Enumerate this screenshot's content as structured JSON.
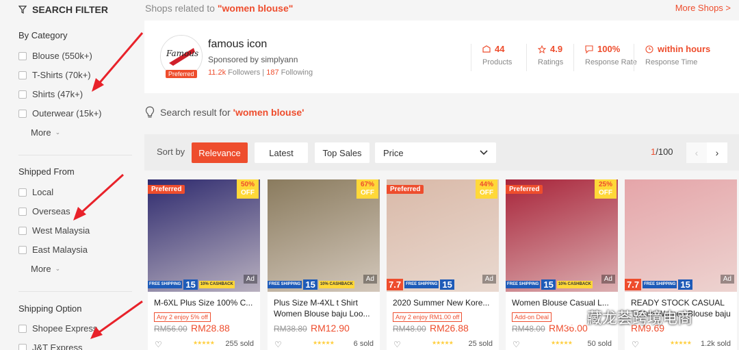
{
  "sidebar": {
    "title": "SEARCH FILTER",
    "sections": [
      {
        "title": "By Category",
        "items": [
          "Blouse (550k+)",
          "T-Shirts (70k+)",
          "Shirts (47k+)",
          "Outerwear (15k+)"
        ],
        "more": "More"
      },
      {
        "title": "Shipped From",
        "items": [
          "Local",
          "Overseas",
          "West Malaysia",
          "East Malaysia"
        ],
        "more": "More"
      },
      {
        "title": "Shipping Option",
        "items": [
          "Shopee Express",
          "J&T Express"
        ]
      }
    ]
  },
  "top": {
    "related_prefix": "Shops related to ",
    "related_keyword": "\"women blouse\"",
    "more_shops": "More Shops >"
  },
  "shop": {
    "name": "famous icon",
    "sponsor": "Sponsored by simplyann",
    "followers_num": "11.2k",
    "followers_label": "Followers",
    "sep": "|",
    "following_num": "187",
    "following_label": "Following",
    "preferred": "Preferred",
    "logo_text": "Famous",
    "stats": [
      {
        "icon": "products-icon",
        "value": "44",
        "label": "Products"
      },
      {
        "icon": "star-icon",
        "value": "4.9",
        "label": "Ratings"
      },
      {
        "icon": "chat-icon",
        "value": "100%",
        "label": "Response Rate"
      },
      {
        "icon": "clock-icon",
        "value": "within hours",
        "label": "Response Time"
      }
    ]
  },
  "search": {
    "prefix": "Search result for ",
    "keyword": "'women blouse'"
  },
  "sort": {
    "label": "Sort by",
    "options": [
      "Relevance",
      "Latest",
      "Top Sales"
    ],
    "active": "Relevance",
    "price": "Price",
    "page_current": "1",
    "page_total": "/100"
  },
  "products": [
    {
      "title": "M-6XL Plus Size 100% C...",
      "preferred": "Preferred",
      "discount": "50%",
      "off": "OFF",
      "ad": "Ad",
      "tag": "Any 2 enjoy 5% off",
      "old": "RM56.00",
      "price": "RM28.88",
      "sold": "255 sold",
      "promo77": false,
      "img_color": "#2e2a6e"
    },
    {
      "title": "Plus Size M-4XL t Shirt Women Blouse baju Loo...",
      "preferred": "",
      "discount": "67%",
      "off": "OFF",
      "ad": "Ad",
      "tag": "",
      "old": "RM38.80",
      "price": "RM12.90",
      "sold": "6 sold",
      "promo77": false,
      "img_color": "#8a7b5e"
    },
    {
      "title": "2020 Summer New Kore...",
      "preferred": "Preferred",
      "discount": "44%",
      "off": "OFF",
      "ad": "Ad",
      "tag": "Any 2 enjoy RM1.00 off",
      "old": "RM48.00",
      "price": "RM26.88",
      "sold": "25 sold",
      "promo77": true,
      "img_color": "#d9b9a8"
    },
    {
      "title": "Women Blouse Casual L...",
      "preferred": "Preferred",
      "discount": "25%",
      "off": "OFF",
      "ad": "Ad",
      "tag": "Add-on Deal",
      "old": "RM48.00",
      "price": "RM36.00",
      "sold": "50 sold",
      "promo77": false,
      "img_color": "#a8243a"
    },
    {
      "title": "READY STOCK CASUAL T-Shirt Women Blouse baju Lai...",
      "preferred": "",
      "discount": "",
      "off": "",
      "ad": "Ad",
      "tag": "",
      "old": "",
      "price": "RM9.69",
      "sold": "1.2k sold",
      "promo77": true,
      "img_color": "#e5a5a9"
    }
  ],
  "promo": {
    "b77": "7.7",
    "free": "FREE SHIPPING",
    "b15": "15",
    "cash": "10% CASHBACK"
  },
  "stars": "★★★★★",
  "heart": "♡",
  "watermark": "藏龙荟跨境电商",
  "colors": {
    "brand": "#ee4d2d",
    "sale_yellow": "#ffd839",
    "promo_blue": "#1e5bb8"
  }
}
